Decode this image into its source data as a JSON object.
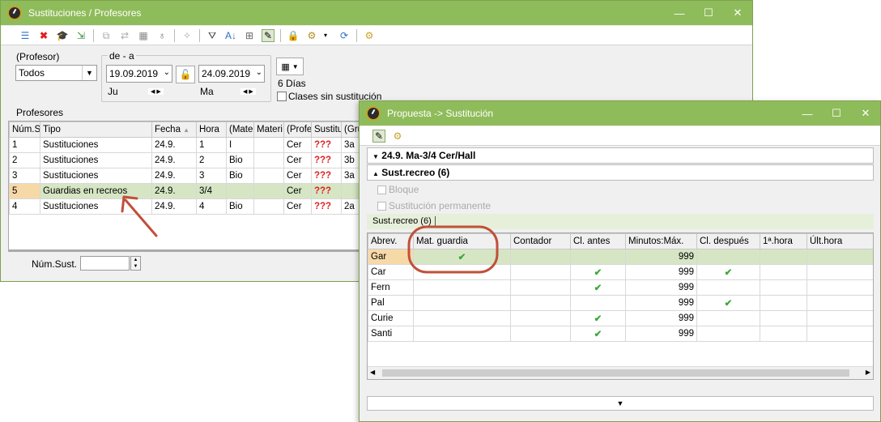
{
  "win1": {
    "title": "Sustituciones / Profesores",
    "controls": {
      "minimize": "—",
      "maximize": "☐",
      "close": "✕"
    },
    "profesor_label": "(Profesor)",
    "profesor_value": "Todos",
    "de_a_label": "de - a",
    "date_from": "19.09.2019",
    "date_to": "24.09.2019",
    "day_from": "Ju",
    "day_to": "Ma",
    "days_count": "6 Días",
    "clases_sin_label": "Clases sin sustitución",
    "section_label": "Profesores",
    "columns": [
      "Núm.S",
      "Tipo",
      "Fecha",
      "Hora",
      "(Mater",
      "Materi",
      "(Profe",
      "Sustitu",
      "(Gru"
    ],
    "rows": [
      {
        "num": "1",
        "tipo": "Sustituciones",
        "fecha": "24.9.",
        "hora": "1",
        "mat": "I",
        "mat2": "",
        "prof": "Cer",
        "sust": "???",
        "gru": "3a"
      },
      {
        "num": "2",
        "tipo": "Sustituciones",
        "fecha": "24.9.",
        "hora": "2",
        "mat": "Bio",
        "mat2": "",
        "prof": "Cer",
        "sust": "???",
        "gru": "3b"
      },
      {
        "num": "3",
        "tipo": "Sustituciones",
        "fecha": "24.9.",
        "hora": "3",
        "mat": "Bio",
        "mat2": "",
        "prof": "Cer",
        "sust": "???",
        "gru": "3a"
      },
      {
        "num": "5",
        "tipo": "Guardias en recreos",
        "fecha": "24.9.",
        "hora": "3/4",
        "mat": "",
        "mat2": "",
        "prof": "Cer",
        "sust": "???",
        "gru": ""
      },
      {
        "num": "4",
        "tipo": "Sustituciones",
        "fecha": "24.9.",
        "hora": "4",
        "mat": "Bio",
        "mat2": "",
        "prof": "Cer",
        "sust": "???",
        "gru": "2a"
      }
    ],
    "num_sust_label": "Núm.Sust."
  },
  "win2": {
    "title": "Propuesta -> Sustitución",
    "controls": {
      "minimize": "—",
      "maximize": "☐",
      "close": "✕"
    },
    "section1": "24.9. Ma-3/4 Cer/Hall",
    "section2": "Sust.recreo (6)",
    "bloque_label": "Bloque",
    "permanente_label": "Sustitución permanente",
    "tab_label": "Sust.recreo (6)",
    "columns": [
      "Abrev.",
      "Mat. guardia",
      "Contador",
      "Cl. antes",
      "Minutos:Máx.",
      "Cl. después",
      "1ª.hora",
      "Últ.hora"
    ],
    "rows": [
      {
        "abrev": "Gar",
        "mat": "✔",
        "cont": "",
        "antes": "",
        "min": "999",
        "despues": "",
        "h1": "",
        "ult": ""
      },
      {
        "abrev": "Car",
        "mat": "",
        "cont": "",
        "antes": "✔",
        "min": "999",
        "despues": "✔",
        "h1": "",
        "ult": ""
      },
      {
        "abrev": "Fern",
        "mat": "",
        "cont": "",
        "antes": "✔",
        "min": "999",
        "despues": "",
        "h1": "",
        "ult": ""
      },
      {
        "abrev": "Pal",
        "mat": "",
        "cont": "",
        "antes": "",
        "min": "999",
        "despues": "✔",
        "h1": "",
        "ult": ""
      },
      {
        "abrev": "Curie",
        "mat": "",
        "cont": "",
        "antes": "✔",
        "min": "999",
        "despues": "",
        "h1": "",
        "ult": ""
      },
      {
        "abrev": "Santi",
        "mat": "",
        "cont": "",
        "antes": "✔",
        "min": "999",
        "despues": "",
        "h1": "",
        "ult": ""
      }
    ]
  },
  "colors": {
    "titlebar": "#8fbc5a",
    "selected_row": "#d6e6c4",
    "callout": "#c0503a"
  }
}
